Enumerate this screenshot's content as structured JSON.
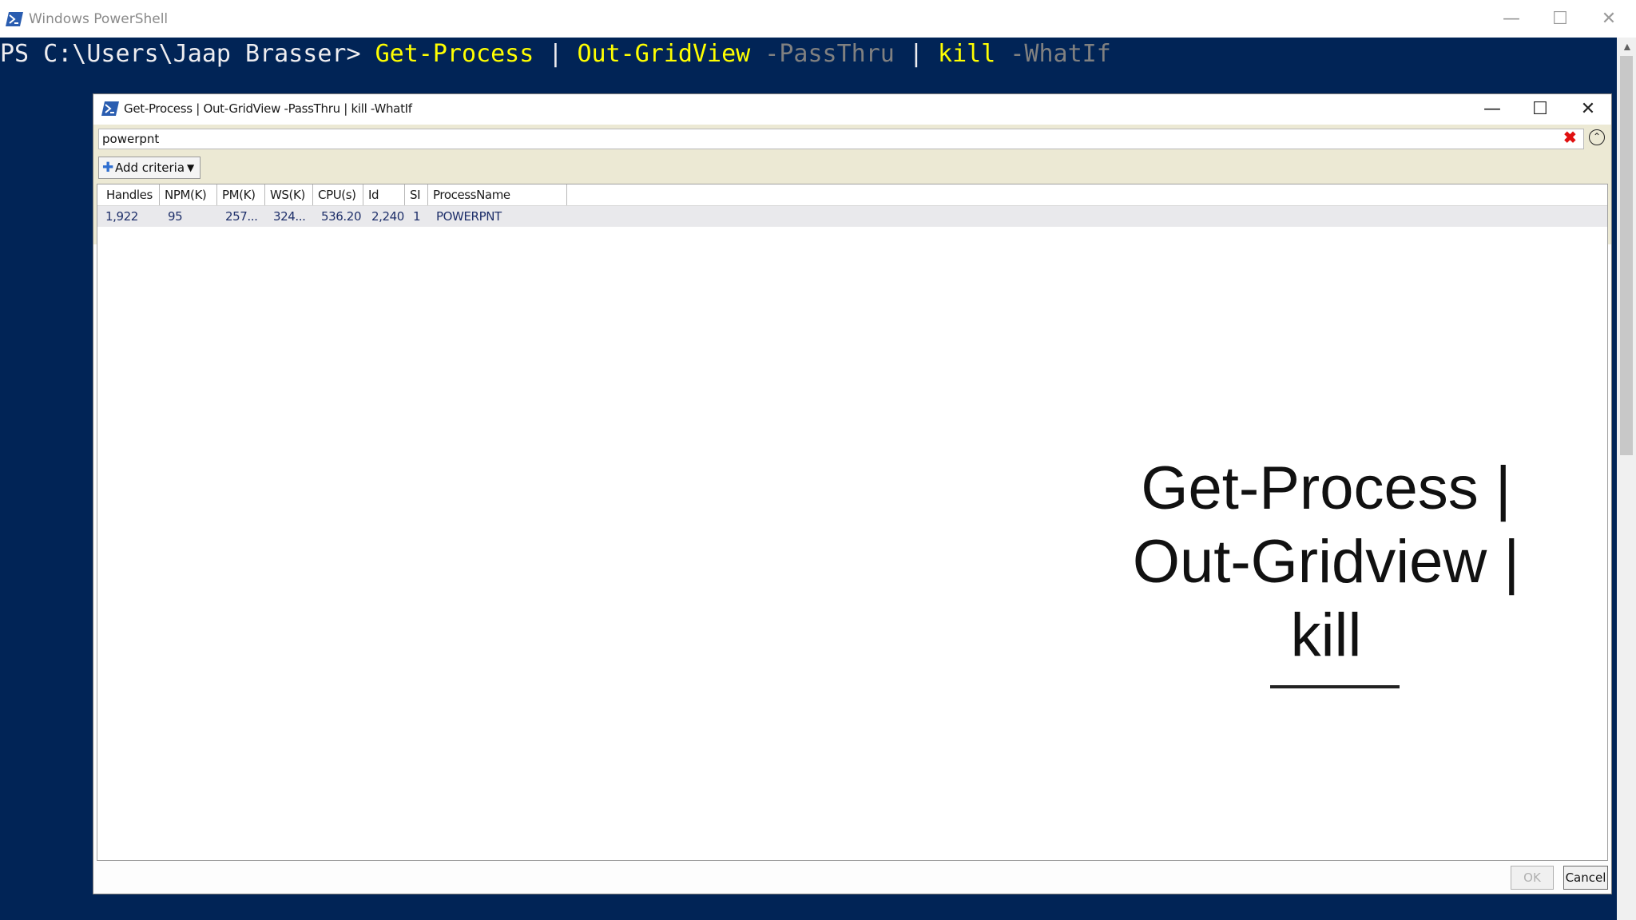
{
  "powershell": {
    "title": "Windows PowerShell",
    "minimize": "—",
    "maximize": "☐",
    "close": "✕",
    "prompt": "PS C:\\Users\\Jaap Brasser> ",
    "command_parts": [
      {
        "text": "Get-Process",
        "kind": "cmd"
      },
      {
        "text": " | ",
        "kind": "plain"
      },
      {
        "text": "Out-GridView",
        "kind": "cmd"
      },
      {
        "text": " -PassThru",
        "kind": "param"
      },
      {
        "text": " | ",
        "kind": "plain"
      },
      {
        "text": "kill",
        "kind": "cmd"
      },
      {
        "text": " -WhatIf",
        "kind": "param"
      }
    ],
    "colors": {
      "console_bg": "#012456",
      "cmd": "#ffff00",
      "param": "#808080",
      "text": "#eeedf0"
    }
  },
  "gridview": {
    "title": "Get-Process | Out-GridView -PassThru | kill -WhatIf",
    "minimize": "—",
    "maximize": "☐",
    "close": "✕",
    "search_value": "powerpnt",
    "clear_icon": "✖",
    "collapse_icon": "⌃",
    "add_criteria": {
      "plus": "✚",
      "label": "Add criteria",
      "caret": "▼"
    },
    "columns": [
      "Handles",
      "NPM(K)",
      "PM(K)",
      "WS(K)",
      "CPU(s)",
      "Id",
      "SI",
      "ProcessName"
    ],
    "rows": [
      [
        "1,922",
        "95",
        "257...",
        "324...",
        "536.20",
        "2,240",
        "1",
        "POWERPNT"
      ]
    ],
    "ok_label": "OK",
    "cancel_label": "Cancel"
  },
  "overlay": {
    "line1": "Get-Process |",
    "line2": "Out-Gridview |",
    "line3": "kill"
  }
}
